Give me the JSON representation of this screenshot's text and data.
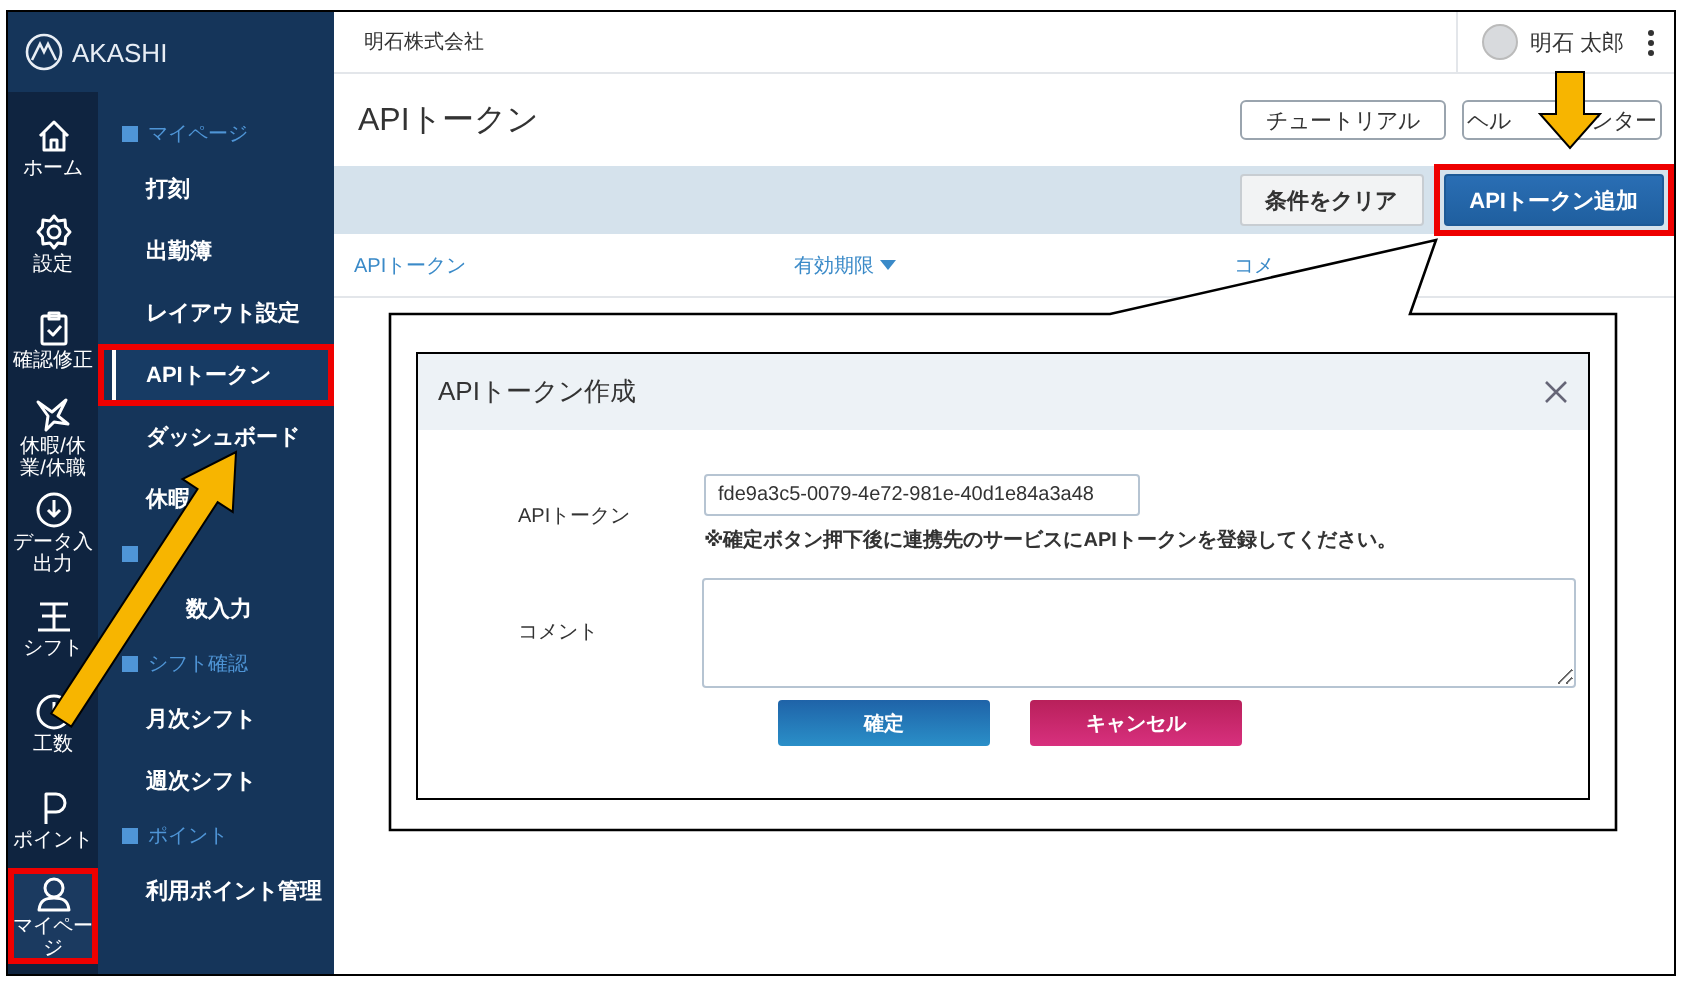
{
  "sidebar": {
    "logo": "AKASHI",
    "rail": [
      {
        "kind": "home",
        "label": "ホーム",
        "selected": false,
        "highlighted": false
      },
      {
        "kind": "gear",
        "label": "設定",
        "selected": false,
        "highlighted": false
      },
      {
        "kind": "clipboard",
        "label": "確認修正",
        "selected": false,
        "highlighted": false
      },
      {
        "kind": "bird",
        "label": "休暇/休業/休職",
        "selected": false,
        "highlighted": false
      },
      {
        "kind": "download",
        "label": "データ入出力",
        "selected": false,
        "highlighted": false
      },
      {
        "kind": "shift",
        "label": "シフト",
        "selected": false,
        "highlighted": false
      },
      {
        "kind": "clock",
        "label": "工数",
        "selected": false,
        "highlighted": false
      },
      {
        "kind": "point",
        "label": "ポイント",
        "selected": false,
        "highlighted": false
      },
      {
        "kind": "person",
        "label": "マイページ",
        "selected": true,
        "highlighted": true
      }
    ],
    "menu": [
      {
        "kind": "section",
        "label": "マイページ"
      },
      {
        "kind": "item",
        "label": "打刻",
        "selected": false,
        "highlighted": false
      },
      {
        "kind": "item",
        "label": "出勤簿",
        "selected": false,
        "highlighted": false
      },
      {
        "kind": "item",
        "label": "レイアウト設定",
        "selected": false,
        "highlighted": false
      },
      {
        "kind": "item",
        "label": "APIトークン",
        "selected": true,
        "highlighted": true
      },
      {
        "kind": "item",
        "label": "ダッシュボード",
        "selected": false,
        "highlighted": false
      },
      {
        "kind": "item",
        "label": "休暇",
        "selected": false,
        "highlighted": false
      },
      {
        "kind": "section"
      },
      {
        "kind": "cut-item",
        "label": "数入力",
        "selected": false,
        "highlighted": false
      },
      {
        "kind": "section",
        "label": "シフト確認"
      },
      {
        "kind": "item",
        "label": "月次シフト",
        "selected": false,
        "highlighted": false
      },
      {
        "kind": "item",
        "label": "週次シフト",
        "selected": false,
        "highlighted": false
      },
      {
        "kind": "section",
        "label": "ポイント"
      },
      {
        "kind": "item",
        "label": "利用ポイント管理",
        "selected": false,
        "highlighted": false
      }
    ]
  },
  "header": {
    "company": "明石株式会社",
    "user": "明石 太郎"
  },
  "page_title": "APIトークン",
  "tutorial_button": "チュートリアル",
  "help_button": {
    "visible_parts": [
      "ヘル",
      "ンター"
    ]
  },
  "filter_bar": {
    "buttons": [
      {
        "kind": "secondary",
        "label": "条件をクリア",
        "highlighted": false
      },
      {
        "kind": "primary",
        "label": "APIトークン追加",
        "highlighted": true
      }
    ]
  },
  "table": {
    "columns": [
      {
        "label": "APIトークン",
        "sorted": false
      },
      {
        "label": "有効期限",
        "sorted": true
      },
      {
        "label": "コメ",
        "sorted": false
      }
    ]
  },
  "dialog": {
    "title": "APIトークン作成",
    "fields": [
      {
        "kind": "input",
        "label": "APIトークン",
        "value": "fde9a3c5-0079-4e72-981e-40d1e84a3a48",
        "note": "※確定ボタン押下後に連携先のサービスにAPIトークンを登録してください。"
      },
      {
        "kind": "textarea",
        "label": "コメント"
      }
    ],
    "buttons": [
      {
        "kind": "primary",
        "label": "確定"
      },
      {
        "kind": "danger",
        "label": "キャンセル"
      }
    ]
  },
  "annotations": [
    {
      "kind": "callout"
    },
    {
      "kind": "up-arrow"
    },
    {
      "kind": "down-arrow"
    }
  ]
}
